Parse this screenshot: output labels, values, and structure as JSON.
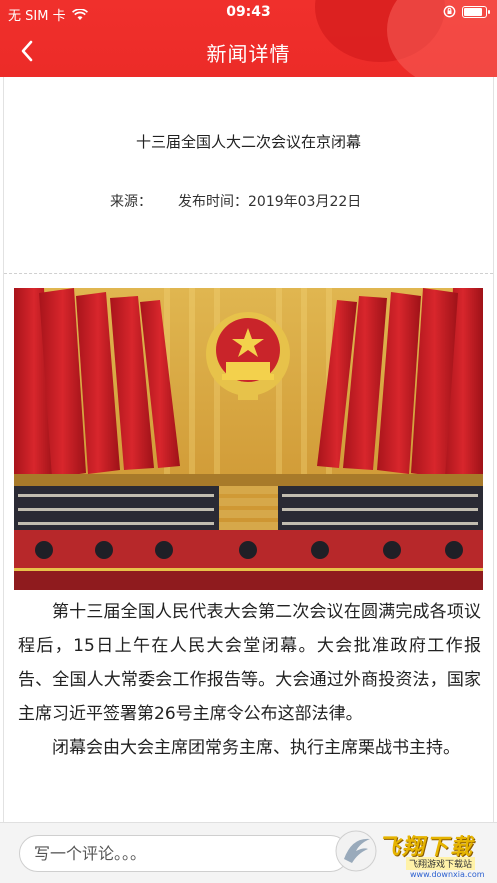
{
  "status_bar": {
    "carrier": "无 SIM 卡",
    "time": "09:43"
  },
  "nav": {
    "title": "新闻详情"
  },
  "article": {
    "title": "十三届全国人大二次会议在京闭幕",
    "source_label": "来源：",
    "publish_time": "发布时间：2019年03月22日",
    "paragraphs": [
      "第十三届全国人民代表大会第二次会议在圆满完成各项议程后，15日上午在人民大会堂闭幕。大会批准政府工作报告、全国人大常委会工作报告等。大会通过外商投资法，国家主席习近平签署第26号主席令公布这部法律。",
      "闭幕会由大会主席团常务主席、执行主席栗战书主持。"
    ]
  },
  "comment": {
    "placeholder": "写一个评论。。。"
  },
  "watermark": {
    "text": "飞翔下载",
    "sub": "飞翔游戏下载站",
    "url": "www.downxia.com"
  },
  "colors": {
    "header_red": "#ec2b28",
    "flag_red": "#c9242a",
    "gold": "#e7c24a"
  }
}
